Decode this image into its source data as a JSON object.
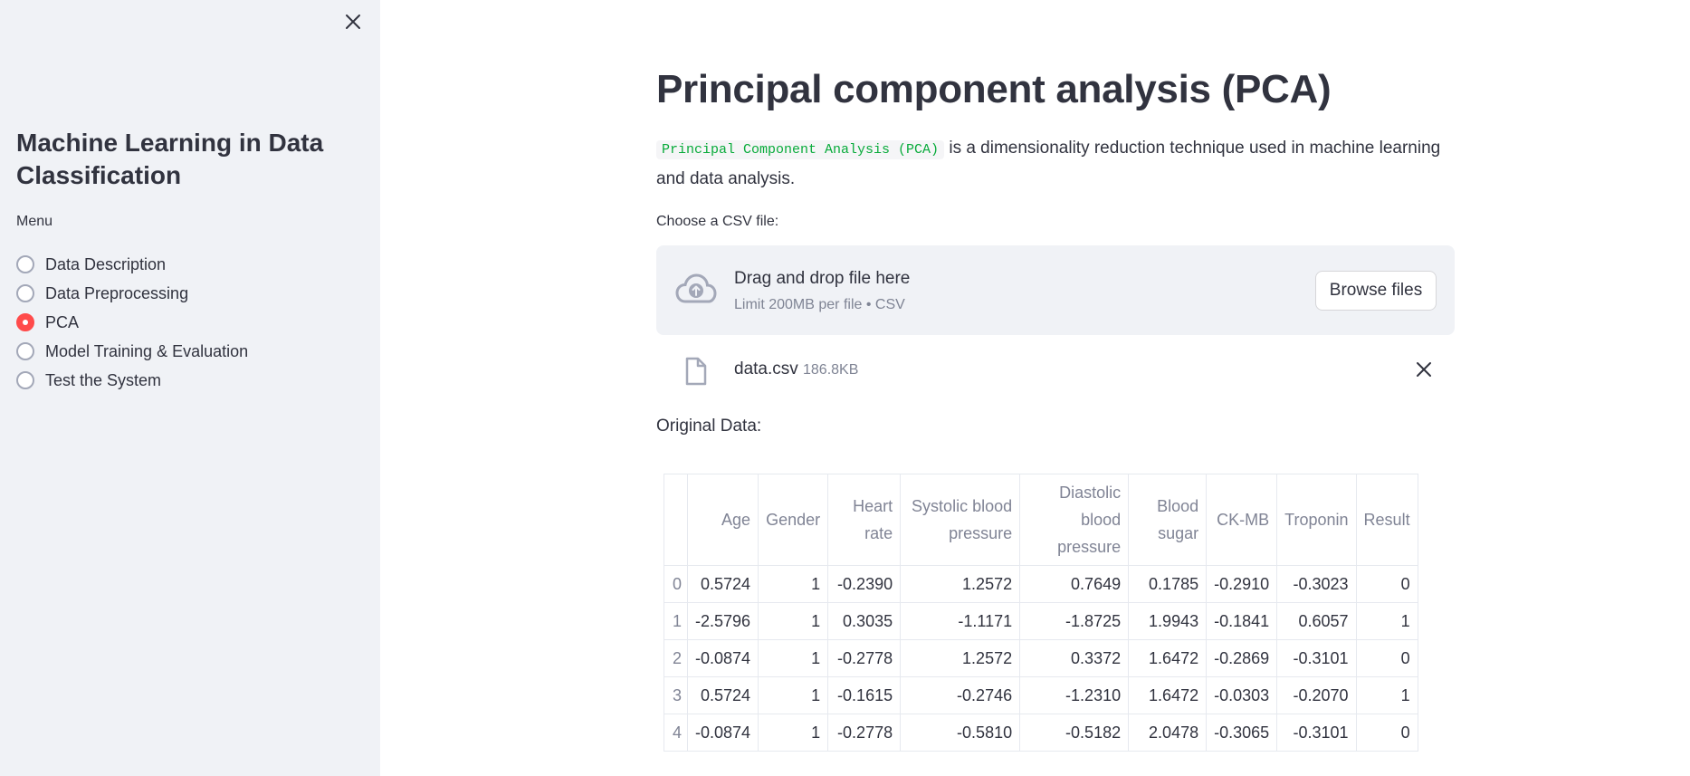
{
  "sidebar": {
    "title": "Machine Learning in Data Classification",
    "menu_label": "Menu",
    "items": [
      {
        "label": "Data Description",
        "selected": false
      },
      {
        "label": "Data Preprocessing",
        "selected": false
      },
      {
        "label": "PCA",
        "selected": true
      },
      {
        "label": "Model Training & Evaluation",
        "selected": false
      },
      {
        "label": "Test the System",
        "selected": false
      }
    ],
    "accent_color": "#ff4b4b"
  },
  "main": {
    "title": "Principal component analysis (PCA)",
    "intro_code": "Principal Component Analysis (PCA)",
    "intro_text": " is a dimensionality reduction technique used in machine learning and data analysis.",
    "uploader": {
      "label": "Choose a CSV file:",
      "drop_text": "Drag and drop file here",
      "limit_text": "Limit 200MB per file • CSV",
      "browse_label": "Browse files",
      "icon": "cloud-upload-icon"
    },
    "file": {
      "name": "data.csv",
      "size": "186.8KB",
      "icon": "file-icon"
    },
    "table_label": "Original Data:",
    "table": {
      "columns": [
        "",
        "Age",
        "Gender",
        "Heart rate",
        "Systolic blood pressure",
        "Diastolic blood pressure",
        "Blood sugar",
        "CK-MB",
        "Troponin",
        "Result"
      ],
      "rows": [
        [
          "0",
          "0.5724",
          "1",
          "-0.2390",
          "1.2572",
          "0.7649",
          "0.1785",
          "-0.2910",
          "-0.3023",
          "0"
        ],
        [
          "1",
          "-2.5796",
          "1",
          "0.3035",
          "-1.1171",
          "-1.8725",
          "1.9943",
          "-0.1841",
          "0.6057",
          "1"
        ],
        [
          "2",
          "-0.0874",
          "1",
          "-0.2778",
          "1.2572",
          "0.3372",
          "1.6472",
          "-0.2869",
          "-0.3101",
          "0"
        ],
        [
          "3",
          "0.5724",
          "1",
          "-0.1615",
          "-0.2746",
          "-1.2310",
          "1.6472",
          "-0.0303",
          "-0.2070",
          "1"
        ],
        [
          "4",
          "-0.0874",
          "1",
          "-0.2778",
          "-0.5810",
          "-0.5182",
          "2.0478",
          "-0.3065",
          "-0.3101",
          "0"
        ]
      ]
    }
  }
}
